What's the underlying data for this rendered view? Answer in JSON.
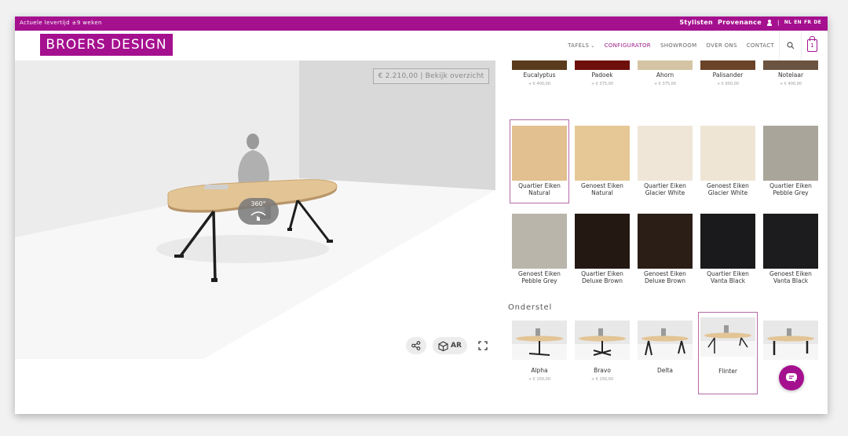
{
  "topbar": {
    "lead_time": "Actuele levertijd ±9 weken",
    "links": [
      "Stylisten",
      "Provenance"
    ],
    "separator": "|",
    "languages": [
      "NL",
      "EN",
      "FR",
      "DE"
    ]
  },
  "header": {
    "logo": "BROERS DESIGN",
    "nav": [
      {
        "label": "TAFELS",
        "has_dropdown": true
      },
      {
        "label": "CONFIGURATOR",
        "active": true
      },
      {
        "label": "SHOWROOM"
      },
      {
        "label": "OVER ONS"
      },
      {
        "label": "CONTACT"
      }
    ],
    "cart_count": "1"
  },
  "viewer": {
    "price_button": "€ 2.210,00 | Bekijk overzicht",
    "rotate_badge": "360°",
    "ar_label": "AR",
    "icons": [
      "share-icon",
      "ar-cube-icon",
      "fullscreen-icon",
      "rotate-360-icon"
    ]
  },
  "materials": {
    "top_row": [
      {
        "name": "Eucalyptus",
        "price": "+ € 400,00",
        "color": "#5a3b1e"
      },
      {
        "name": "Padoek",
        "price": "+ € 375,00",
        "color": "#6e0f0c"
      },
      {
        "name": "Ahorn",
        "price": "+ € 375,00",
        "color": "#d4c4a4"
      },
      {
        "name": "Palisander",
        "price": "+ € 950,00",
        "color": "#6a4328"
      },
      {
        "name": "Notelaar",
        "price": "+ € 400,00",
        "color": "#6a5340"
      }
    ],
    "row_2": [
      {
        "name_1": "Quartier Eiken",
        "name_2": "Natural",
        "color": "#e2c08f",
        "selected": true
      },
      {
        "name_1": "Genoest Eiken",
        "name_2": "Natural",
        "color": "#e5c896"
      },
      {
        "name_1": "Quartier Eiken",
        "name_2": "Glacier White",
        "color": "#efe6d8"
      },
      {
        "name_1": "Genoest Eiken",
        "name_2": "Glacier White",
        "color": "#eee5d5"
      },
      {
        "name_1": "Quartier Eiken",
        "name_2": "Pebble Grey",
        "color": "#aaa59a"
      }
    ],
    "row_3": [
      {
        "name_1": "Genoest Eiken",
        "name_2": "Pebble Grey",
        "color": "#bab5ab"
      },
      {
        "name_1": "Quartier Eiken",
        "name_2": "Deluxe Brown",
        "color": "#241812"
      },
      {
        "name_1": "Genoest Eiken",
        "name_2": "Deluxe Brown",
        "color": "#2a1e17"
      },
      {
        "name_1": "Quartier Eiken",
        "name_2": "Vanta Black",
        "color": "#1a1a1c"
      },
      {
        "name_1": "Genoest Eiken",
        "name_2": "Vanta Black",
        "color": "#1c1c1e"
      }
    ]
  },
  "frame_section": {
    "title": "Onderstel",
    "options": [
      {
        "name": "Alpha",
        "price": "+ € 150,00"
      },
      {
        "name": "Bravo",
        "price": "+ € 150,00"
      },
      {
        "name": "Delta",
        "price": ""
      },
      {
        "name": "Flinter",
        "price": "",
        "selected": true
      },
      {
        "name": "Hotel",
        "price": ""
      }
    ]
  },
  "colors": {
    "brand": "#a5108f",
    "selection_border": "#b46aa8"
  }
}
